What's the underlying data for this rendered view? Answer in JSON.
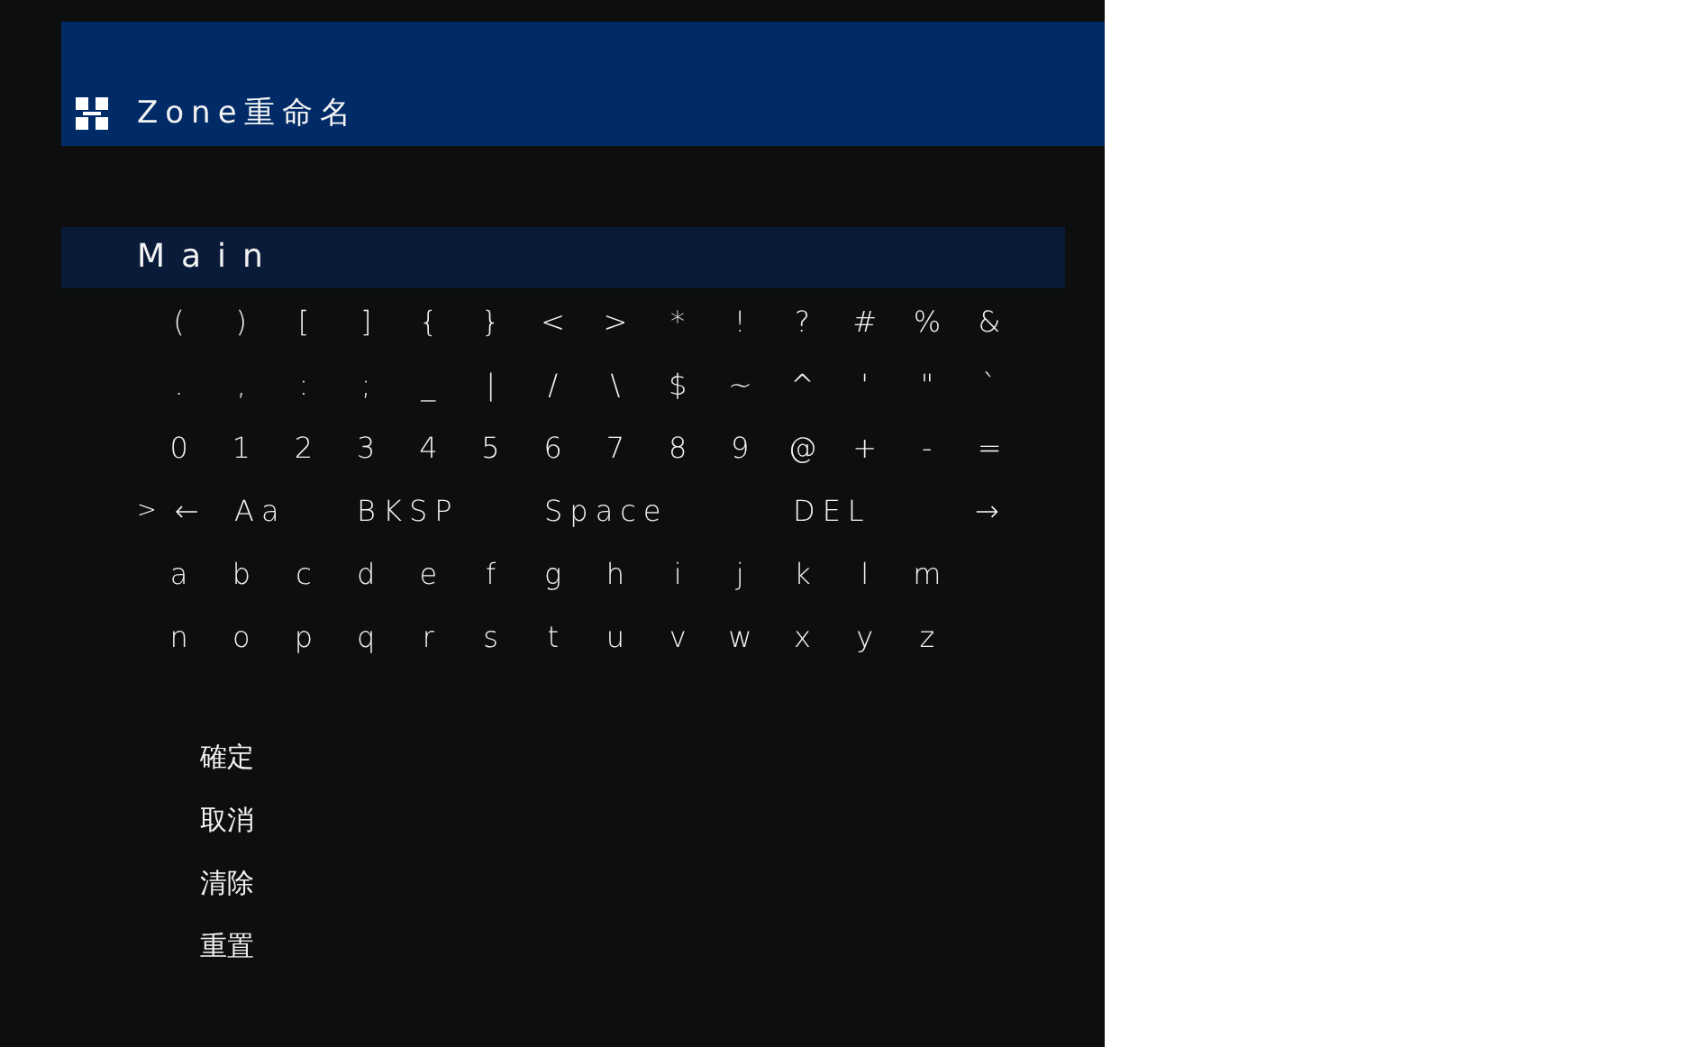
{
  "header": {
    "title": "Zone重命名"
  },
  "name_field": {
    "value": "Main"
  },
  "keyboard": {
    "cursor_mark": ">",
    "rows": [
      {
        "kind": "chars",
        "keys": [
          {
            "label": "(",
            "selected": false
          },
          {
            "label": ")",
            "selected": false
          },
          {
            "label": "[",
            "selected": false
          },
          {
            "label": "]",
            "selected": false
          },
          {
            "label": "{",
            "selected": false
          },
          {
            "label": "}",
            "selected": false
          },
          {
            "label": "<",
            "selected": false
          },
          {
            "label": ">",
            "selected": false
          },
          {
            "label": "*",
            "selected": false
          },
          {
            "label": "!",
            "selected": false
          },
          {
            "label": "?",
            "selected": false
          },
          {
            "label": "#",
            "selected": false
          },
          {
            "label": "%",
            "selected": false
          },
          {
            "label": "&",
            "selected": false
          }
        ]
      },
      {
        "kind": "chars",
        "keys": [
          {
            "label": ".",
            "selected": false
          },
          {
            "label": ",",
            "selected": false
          },
          {
            "label": ":",
            "selected": false
          },
          {
            "label": ";",
            "selected": false
          },
          {
            "label": "_",
            "selected": false
          },
          {
            "label": "|",
            "selected": false
          },
          {
            "label": "/",
            "selected": false
          },
          {
            "label": "\\",
            "selected": false
          },
          {
            "label": "$",
            "selected": false
          },
          {
            "label": "~",
            "selected": false
          },
          {
            "label": "^",
            "selected": false
          },
          {
            "label": "'",
            "selected": false
          },
          {
            "label": "\"",
            "selected": false
          },
          {
            "label": "`",
            "selected": false
          }
        ]
      },
      {
        "kind": "chars",
        "keys": [
          {
            "label": "0",
            "selected": false
          },
          {
            "label": "1",
            "selected": false
          },
          {
            "label": "2",
            "selected": false
          },
          {
            "label": "3",
            "selected": false
          },
          {
            "label": "4",
            "selected": false
          },
          {
            "label": "5",
            "selected": false
          },
          {
            "label": "6",
            "selected": false
          },
          {
            "label": "7",
            "selected": false
          },
          {
            "label": "8",
            "selected": false
          },
          {
            "label": "9",
            "selected": false
          },
          {
            "label": "@",
            "selected": false
          },
          {
            "label": "+",
            "selected": false
          },
          {
            "label": "-",
            "selected": false
          },
          {
            "label": "=",
            "selected": false
          }
        ]
      },
      {
        "kind": "functions",
        "keys": [
          {
            "label": "←",
            "selected": true
          },
          {
            "label": "Aa",
            "selected": false
          },
          {
            "label": "BKSP",
            "selected": false
          },
          {
            "label": "Space",
            "selected": false
          },
          {
            "label": "DEL",
            "selected": false
          },
          {
            "label": "→",
            "selected": false
          }
        ]
      },
      {
        "kind": "chars",
        "keys": [
          {
            "label": "a",
            "selected": false
          },
          {
            "label": "b",
            "selected": false
          },
          {
            "label": "c",
            "selected": false
          },
          {
            "label": "d",
            "selected": false
          },
          {
            "label": "e",
            "selected": false
          },
          {
            "label": "f",
            "selected": false
          },
          {
            "label": "g",
            "selected": false
          },
          {
            "label": "h",
            "selected": false
          },
          {
            "label": "i",
            "selected": false
          },
          {
            "label": "j",
            "selected": false
          },
          {
            "label": "k",
            "selected": false
          },
          {
            "label": "l",
            "selected": false
          },
          {
            "label": "m",
            "selected": false
          }
        ]
      },
      {
        "kind": "chars",
        "keys": [
          {
            "label": "n",
            "selected": false
          },
          {
            "label": "o",
            "selected": false
          },
          {
            "label": "p",
            "selected": false
          },
          {
            "label": "q",
            "selected": false
          },
          {
            "label": "r",
            "selected": false
          },
          {
            "label": "s",
            "selected": false
          },
          {
            "label": "t",
            "selected": false
          },
          {
            "label": "u",
            "selected": false
          },
          {
            "label": "v",
            "selected": false
          },
          {
            "label": "w",
            "selected": false
          },
          {
            "label": "x",
            "selected": false
          },
          {
            "label": "y",
            "selected": false
          },
          {
            "label": "z",
            "selected": false
          }
        ]
      }
    ]
  },
  "menu": [
    {
      "label": "確定"
    },
    {
      "label": "取消"
    },
    {
      "label": "清除"
    },
    {
      "label": "重置"
    }
  ]
}
